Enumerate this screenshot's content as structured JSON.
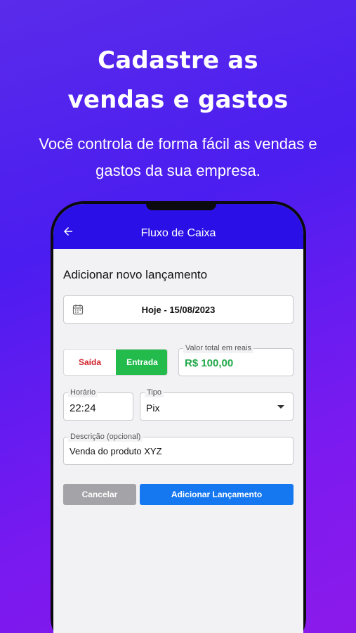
{
  "promo": {
    "headline_line1": "Cadastre as",
    "headline_line2": "vendas e gastos",
    "subtitle_line1": "Você controla de forma fácil as vendas e",
    "subtitle_line2": "gastos da sua empresa."
  },
  "appbar": {
    "title": "Fluxo de Caixa",
    "back_icon": "arrow-left-icon"
  },
  "form": {
    "section_title": "Adicionar novo lançamento",
    "date": {
      "icon": "calendar-icon",
      "value": "Hoje - 15/08/2023"
    },
    "toggle": {
      "saida_label": "Saída",
      "entrada_label": "Entrada",
      "selected": "Entrada"
    },
    "valor": {
      "label": "Valor total em reais",
      "value": "R$ 100,00"
    },
    "horario": {
      "label": "Horário",
      "value": "22:24"
    },
    "tipo": {
      "label": "Tipo",
      "value": "Pix",
      "icon": "dropdown-arrow-icon"
    },
    "descricao": {
      "label": "Descrição (opcional)",
      "value": "Venda do produto XYZ"
    },
    "buttons": {
      "cancel_label": "Cancelar",
      "add_label": "Adicionar Lançamento"
    }
  },
  "colors": {
    "appbar": "#2a10e6",
    "entrada": "#22bb4c",
    "saida_text": "#d0222a",
    "valor_text": "#22a84a",
    "primary_button": "#1578f0",
    "cancel_button": "#a3a3a8"
  }
}
